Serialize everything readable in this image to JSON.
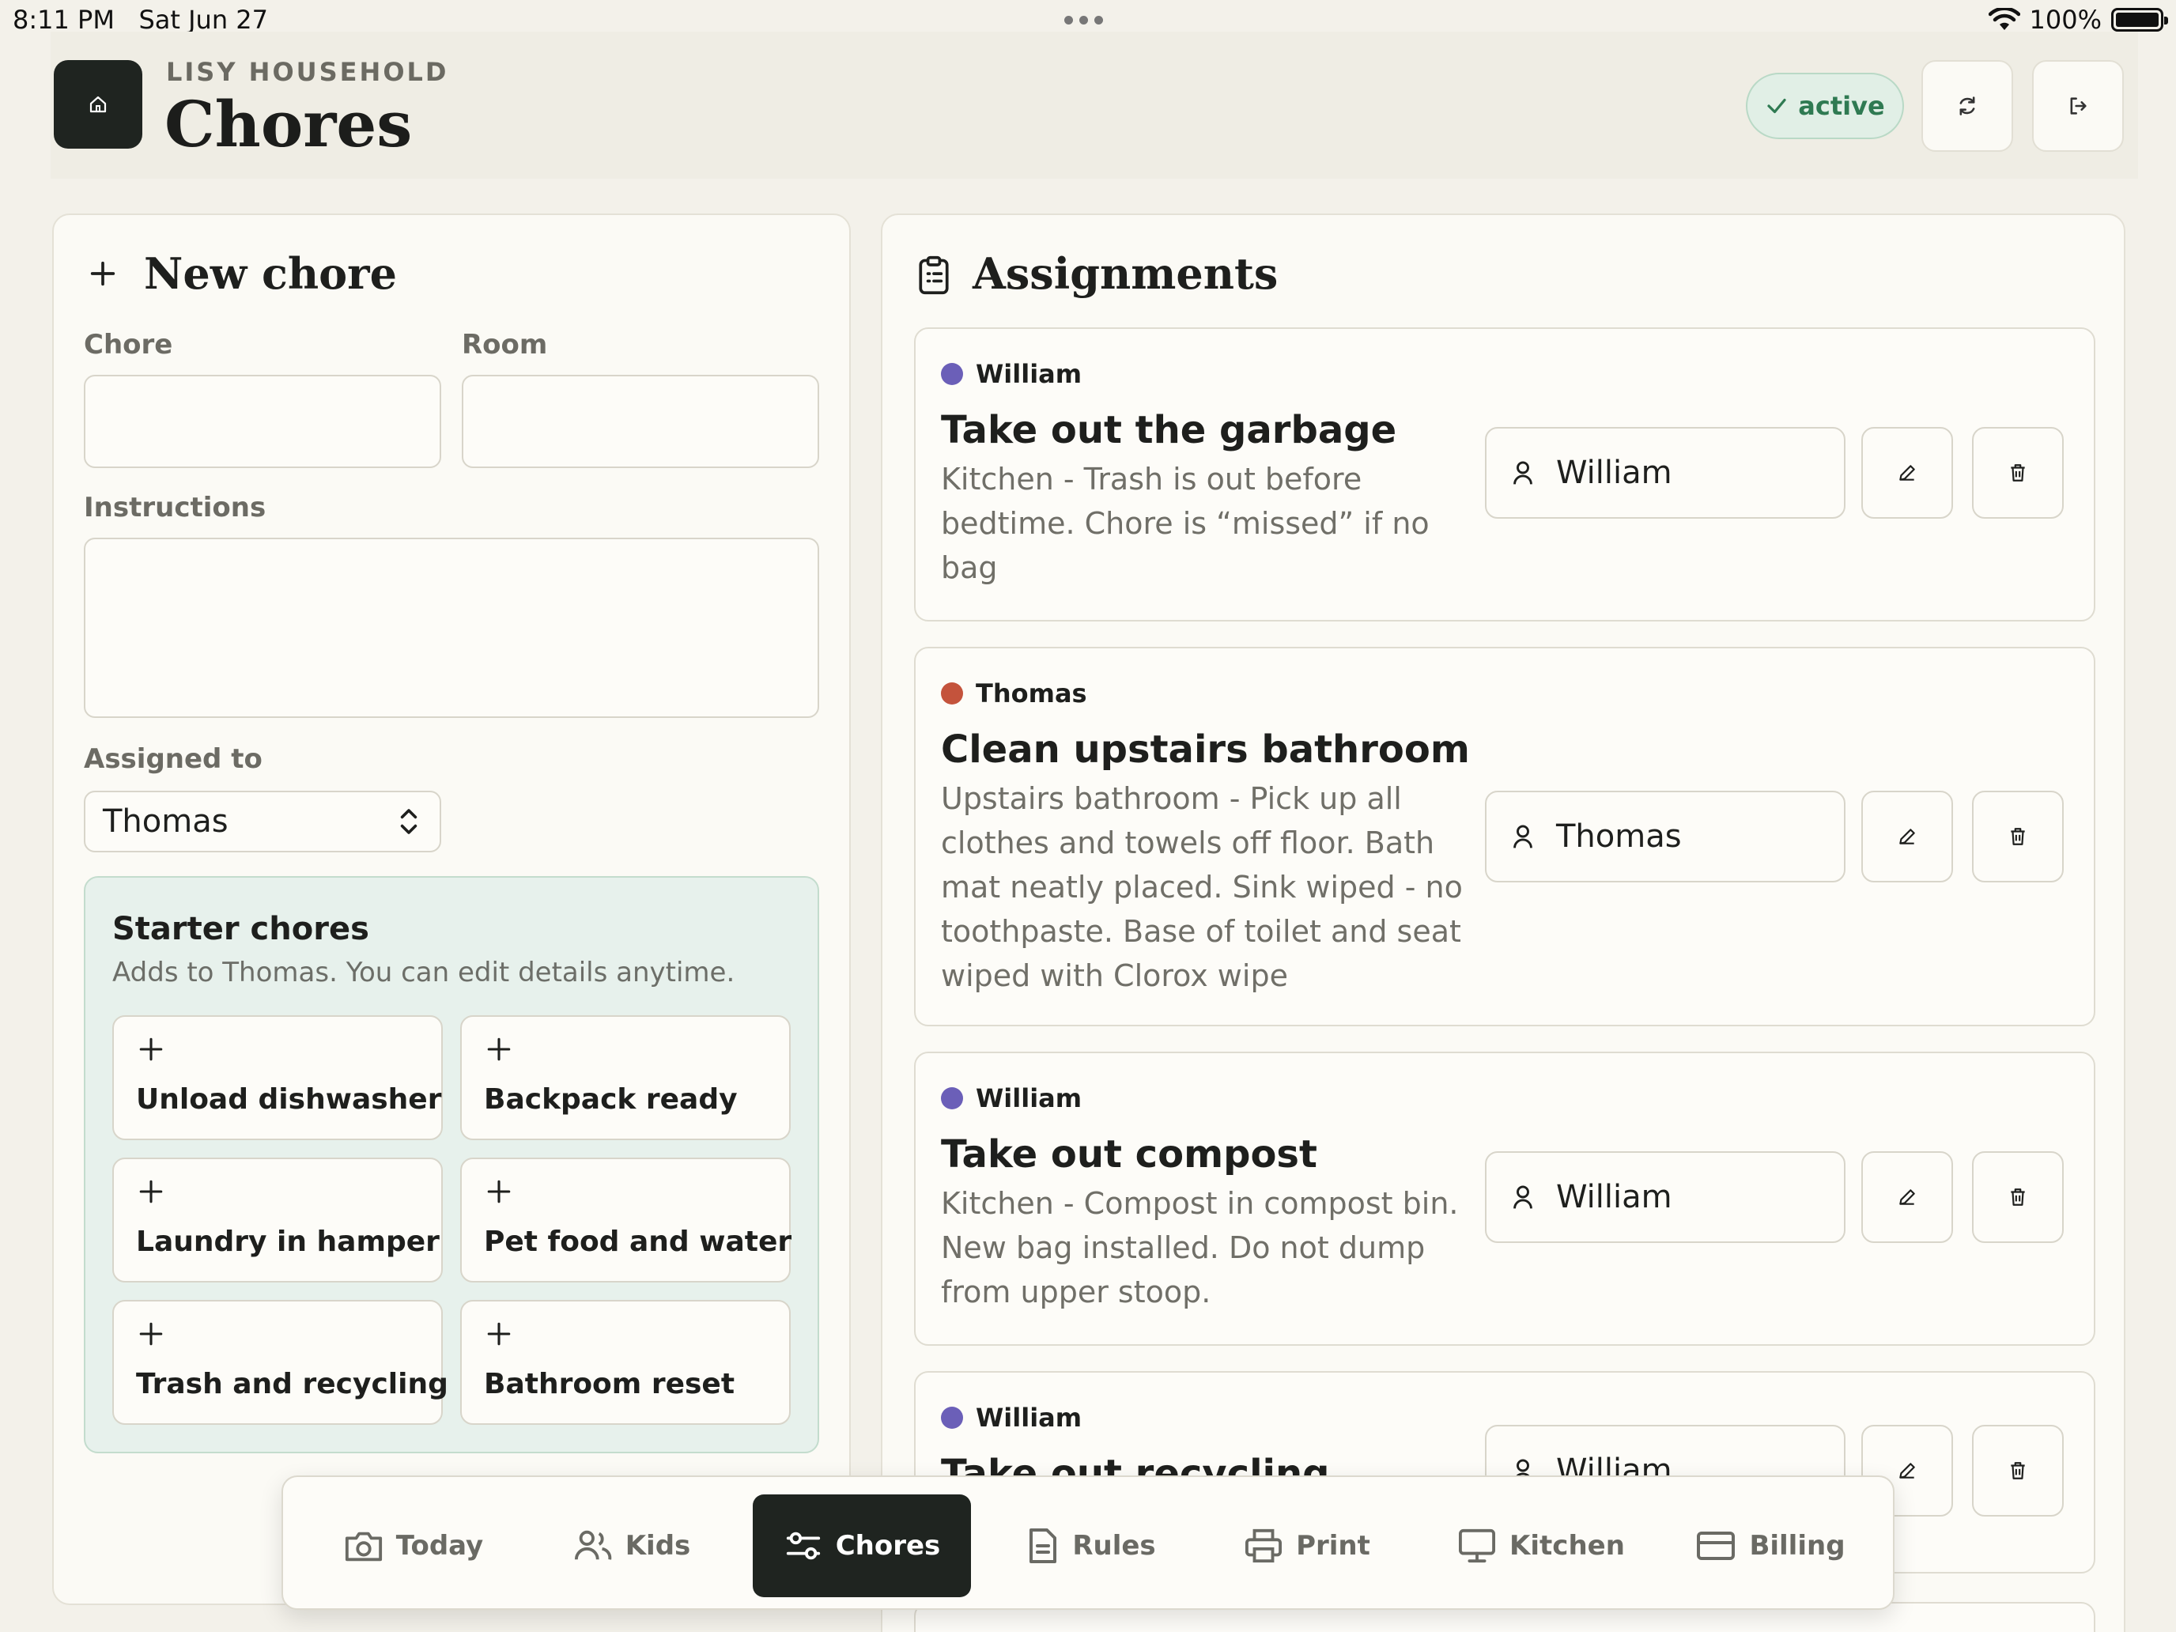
{
  "status_bar": {
    "time": "8:11 PM",
    "date": "Sat Jun 27",
    "battery": "100%"
  },
  "header": {
    "eyebrow": "LISY HOUSEHOLD",
    "title": "Chores",
    "status": "active"
  },
  "new_chore": {
    "title": "New chore",
    "chore_label": "Chore",
    "chore_value": "",
    "room_label": "Room",
    "room_value": "",
    "instructions_label": "Instructions",
    "instructions_value": "",
    "assigned_label": "Assigned to",
    "assigned_value": "Thomas",
    "starter": {
      "title": "Starter chores",
      "subtitle": "Adds to Thomas. You can edit details anytime.",
      "items": [
        "Unload dishwasher",
        "Backpack ready",
        "Laundry in hamper",
        "Pet food and water",
        "Trash and recycling",
        "Bathroom reset"
      ]
    }
  },
  "assignments": {
    "title": "Assignments",
    "items": [
      {
        "kid": "William",
        "kid_color": "#6b5fb8",
        "title": "Take out the garbage",
        "description": "Kitchen - Trash is out before bedtime. Chore is “missed” if no bag",
        "assignee": "William"
      },
      {
        "kid": "Thomas",
        "kid_color": "#c4533c",
        "title": "Clean upstairs bathroom",
        "description": "Upstairs bathroom - Pick up all clothes and towels off floor. Bath mat neatly placed. Sink wiped - no toothpaste. Base of toilet and seat wiped with Clorox wipe",
        "assignee": "Thomas"
      },
      {
        "kid": "William",
        "kid_color": "#6b5fb8",
        "title": "Take out compost",
        "description": "Kitchen - Compost in compost bin. New bag installed. Do not dump from upper stoop.",
        "assignee": "William"
      },
      {
        "kid": "William",
        "kid_color": "#6b5fb8",
        "title": "Take out recycling",
        "description": "",
        "assignee": "William"
      }
    ]
  },
  "nav": {
    "items": [
      {
        "label": "Today",
        "icon": "camera-icon"
      },
      {
        "label": "Kids",
        "icon": "users-icon"
      },
      {
        "label": "Chores",
        "icon": "sliders-icon"
      },
      {
        "label": "Rules",
        "icon": "document-icon"
      },
      {
        "label": "Print",
        "icon": "printer-icon"
      },
      {
        "label": "Kitchen",
        "icon": "monitor-icon"
      },
      {
        "label": "Billing",
        "icon": "credit-card-icon"
      }
    ],
    "active": "Chores"
  },
  "colors": {
    "accent_dark": "#1f2420",
    "active_green": "#2f7a52",
    "starter_bg": "#e7f1ec",
    "page_bg": "#f3f1ea"
  }
}
